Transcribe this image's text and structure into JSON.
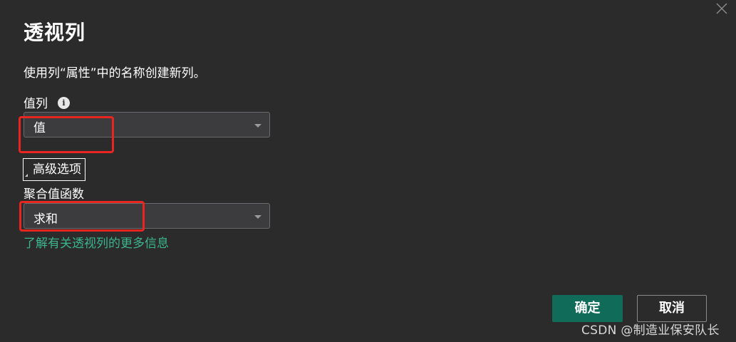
{
  "dialog": {
    "title": "透视列",
    "description": "使用列“属性”中的名称创建新列。",
    "value_column_label": "值列",
    "value_column_selected": "值",
    "advanced_options_label": "高级选项",
    "aggregate_function_label": "聚合值函数",
    "aggregate_function_selected": "求和",
    "learn_more_link": "了解有关透视列的更多信息",
    "ok_label": "确定",
    "cancel_label": "取消"
  },
  "icons": {
    "close": "close-icon",
    "info": "info-icon",
    "caret": "chevron-down-icon"
  },
  "watermark": "CSDN @制造业保安队长",
  "colors": {
    "background": "#2b2b2b",
    "primary_button": "#106b58",
    "link": "#3bb58e",
    "highlight": "#e8261f"
  }
}
